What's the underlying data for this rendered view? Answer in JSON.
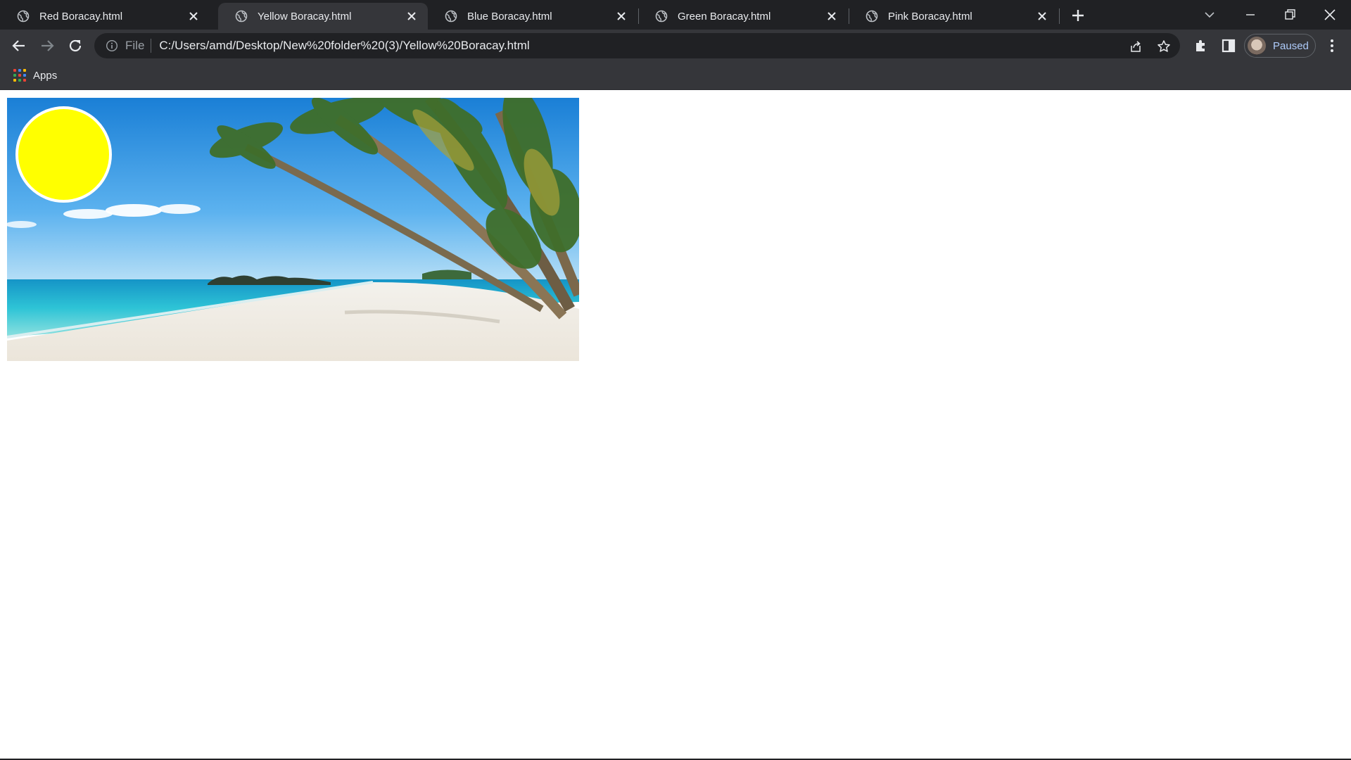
{
  "browser": {
    "tabs": [
      {
        "title": "Red Boracay.html",
        "active": false
      },
      {
        "title": "Yellow Boracay.html",
        "active": true
      },
      {
        "title": "Blue Boracay.html",
        "active": false
      },
      {
        "title": "Green Boracay.html",
        "active": false
      },
      {
        "title": "Pink Boracay.html",
        "active": false
      }
    ],
    "address": {
      "scheme_label": "File",
      "url": "C:/Users/amd/Desktop/New%20folder%20(3)/Yellow%20Boracay.html"
    },
    "profile": {
      "status": "Paused"
    },
    "bookmarks": {
      "apps_label": "Apps"
    }
  },
  "page": {
    "circle_color": "#ffff00",
    "image_subject": "beach"
  },
  "colors": {
    "tabstrip": "#202124",
    "toolbar": "#35363a",
    "text": "#e8eaed",
    "accent": "#aecbfa"
  }
}
